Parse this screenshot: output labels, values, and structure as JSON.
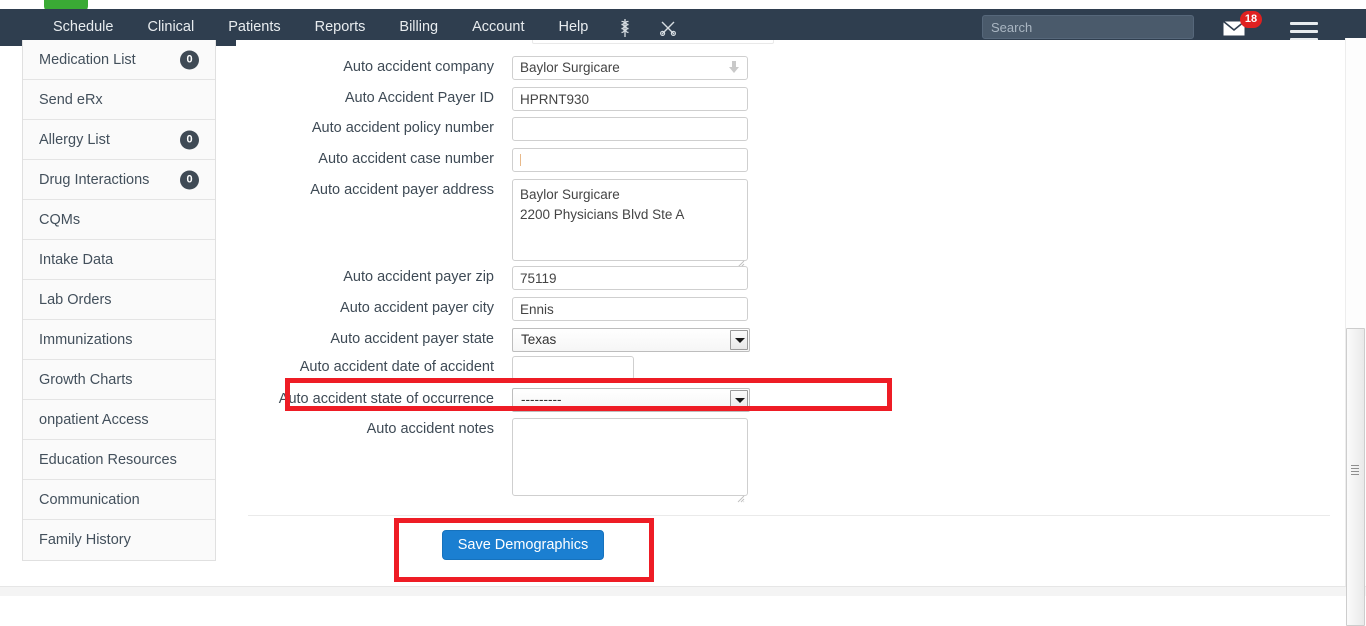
{
  "navbar": {
    "items": [
      {
        "label": "Schedule"
      },
      {
        "label": "Clinical"
      },
      {
        "label": "Patients"
      },
      {
        "label": "Reports"
      },
      {
        "label": "Billing"
      },
      {
        "label": "Account"
      },
      {
        "label": "Help"
      }
    ],
    "icons": [
      {
        "name": "caduceus-icon",
        "glyph": "⚕"
      },
      {
        "name": "scissors-icon",
        "glyph": "✂"
      }
    ],
    "search": {
      "value": "",
      "placeholder": "Search"
    },
    "mail": {
      "badge": "18"
    },
    "background_color": "#2f3e4f"
  },
  "sidebar": {
    "items": [
      {
        "label": "Medication List",
        "count": "0"
      },
      {
        "label": "Send eRx",
        "count": ""
      },
      {
        "label": "Allergy List",
        "count": "0"
      },
      {
        "label": "Drug Interactions",
        "count": "0"
      },
      {
        "label": "CQMs",
        "count": ""
      },
      {
        "label": "Intake Data",
        "count": ""
      },
      {
        "label": "Lab Orders",
        "count": ""
      },
      {
        "label": "Immunizations",
        "count": ""
      },
      {
        "label": "Growth Charts",
        "count": ""
      },
      {
        "label": "onpatient Access",
        "count": ""
      },
      {
        "label": "Education Resources",
        "count": ""
      },
      {
        "label": "Communication",
        "count": ""
      },
      {
        "label": "Family History",
        "count": ""
      }
    ]
  },
  "form": {
    "fields": [
      {
        "label": "Auto accident company",
        "value": "Baylor Surgicare",
        "type": "combobox"
      },
      {
        "label": "Auto Accident Payer ID",
        "value": "HPRNT930",
        "type": "text"
      },
      {
        "label": "Auto accident policy number",
        "value": "",
        "type": "text"
      },
      {
        "label": "Auto accident case number",
        "value": "",
        "type": "text"
      },
      {
        "label": "Auto accident payer address",
        "value": "Baylor Surgicare\n2200 Physicians Blvd Ste A",
        "type": "textarea"
      },
      {
        "label": "Auto accident payer zip",
        "value": "75119",
        "type": "text"
      },
      {
        "label": "Auto accident payer city",
        "value": "Ennis",
        "type": "text"
      },
      {
        "label": "Auto accident payer state",
        "value": "Texas",
        "type": "select"
      },
      {
        "label": "Auto accident date of accident",
        "value": "",
        "type": "text-narrow"
      },
      {
        "label": "Auto accident state of occurrence",
        "value": "---------",
        "type": "select"
      },
      {
        "label": "Auto accident notes",
        "value": "",
        "type": "textarea"
      }
    ]
  },
  "actions": {
    "save_label": "Save Demographics",
    "save_color": "#1b7fd1"
  },
  "highlights": {
    "accent_color": "#ee1c25",
    "regions": [
      {
        "name": "state-of-occurrence-highlight"
      },
      {
        "name": "save-demographics-highlight"
      }
    ]
  }
}
